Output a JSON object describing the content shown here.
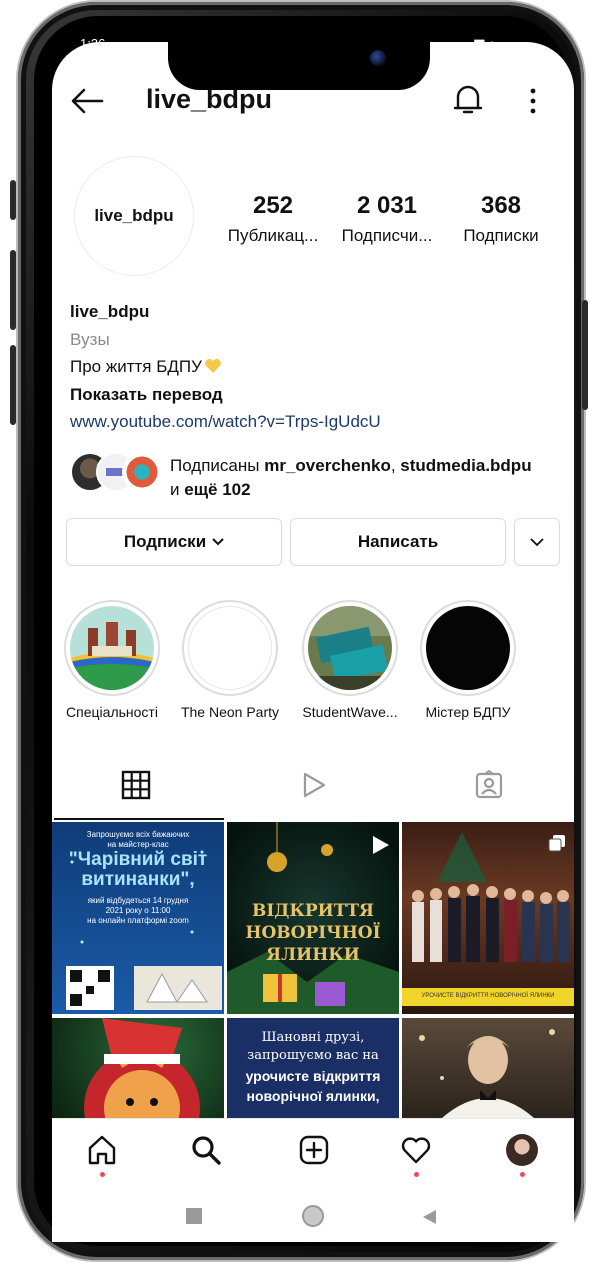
{
  "status_bar": {
    "time": "1:36",
    "icons": "signal-wifi-battery"
  },
  "header": {
    "username": "live_bdpu"
  },
  "profile": {
    "avatar_text": "live_bdpu",
    "stats": [
      {
        "value": "252",
        "label": "Публикац..."
      },
      {
        "value": "2 031",
        "label": "Подписчи..."
      },
      {
        "value": "368",
        "label": "Подписки"
      }
    ],
    "name": "live_bdpu",
    "category": "Вузы",
    "bio": "Про життя БДПУ",
    "translate": "Показать перевод",
    "link": "www.youtube.com/watch?v=Trps-IgUdcU"
  },
  "followed_by": {
    "prefix": "Подписаны ",
    "user1": "mr_overchenko",
    "sep": ", ",
    "user2": "studmedia.bdpu",
    "and": "и ",
    "more": "ещё 102"
  },
  "buttons": {
    "following": "Подписки",
    "message": "Написать"
  },
  "highlights": [
    {
      "label": "Спеціальності"
    },
    {
      "label": "The Neon Party"
    },
    {
      "label": "StudentWave..."
    },
    {
      "label": "Містер БДПУ"
    }
  ],
  "grid_posts": {
    "p1": {
      "line1": "Запрошуємо всіх бажаючих",
      "line2": "на майстер-клас",
      "title": "\"Чарівний світ витинанки\",",
      "line3": "який відбудеться 14 грудня",
      "line4": "2021 року о 11:00",
      "line5": "на онлайн платформі zoom"
    },
    "p2": {
      "title": "ВІДКРИТТЯ НОВОРІЧНОЇ ЯЛИНКИ"
    },
    "p3": {
      "caption": "УРОЧИСТЕ ВІДКРИТТЯ НОВОРІЧНОЇ ЯЛИНКИ"
    },
    "p5": {
      "line1": "Шановні друзі,",
      "line2": "запрошуємо вас на",
      "line3": "урочисте відкриття",
      "line4": "новорічної ялинки,"
    }
  },
  "colors": {
    "accent": "#ed4956",
    "link": "#1d3a6a",
    "highlight_yellow": "#f7c948"
  }
}
